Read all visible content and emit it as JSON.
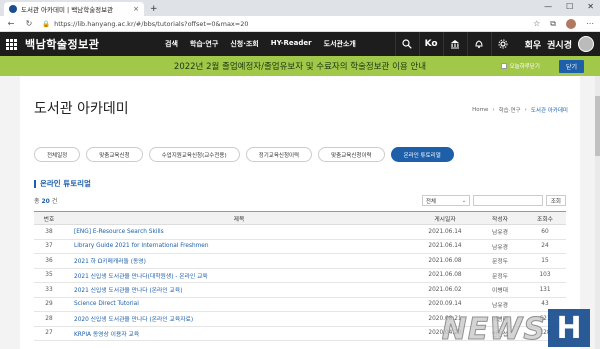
{
  "browser": {
    "tab_title": "도서관 아카데미 | 백남학술정보관",
    "tab_close": "×",
    "new_tab": "+",
    "win_min": "—",
    "win_max": "☐",
    "win_close": "✕",
    "url": "https://lib.hanyang.ac.kr/#/bbs/tutorials?offset=0&max=20"
  },
  "site": {
    "logo": "백남학술정보관",
    "nav": [
      "검색",
      "학습·연구",
      "신청·조회",
      "HY-Reader",
      "도서관소개"
    ],
    "lang_label": "Ko",
    "user_prefix": "회우",
    "user_name": "권시경"
  },
  "notice": {
    "text": "2022년 2월 졸업예정자/졸업유보자 및 수료자의 학술정보관 이용 안내",
    "checkbox_label": "오늘하루닫기",
    "close_label": "닫기"
  },
  "page": {
    "title": "도서관 아카데미",
    "breadcrumb": [
      "Home",
      "학습·연구",
      "도서관 아카데미"
    ],
    "tabs": [
      "전체일정",
      "맞춤교육신청",
      "수업지원교육신청(교수전용)",
      "정기교육신청이력",
      "맞춤교육신청이력",
      "온라인 튜토리얼"
    ],
    "active_tab": 5,
    "section_title": "온라인 튜토리얼",
    "total_prefix": "총",
    "total_count": "20",
    "total_suffix": "건",
    "search_select": "전체",
    "search_button": "조회"
  },
  "table": {
    "headers": [
      "번호",
      "제목",
      "게시일자",
      "작성자",
      "조회수"
    ],
    "rows": [
      {
        "no": "38",
        "title": "[ENG] E-Resource Search Skills",
        "date": "2021.06.14",
        "author": "남유경",
        "views": "60"
      },
      {
        "no": "37",
        "title": "Library Guide 2021 for International Freshmen",
        "date": "2021.06.14",
        "author": "남유경",
        "views": "24"
      },
      {
        "no": "36",
        "title": "2021 하 Ω키메캐러돌 (동영)",
        "date": "2021.06.08",
        "author": "문정두",
        "views": "15"
      },
      {
        "no": "35",
        "title": "2021 신입생 도서관을 만나다(대학원생) - 온라인 교육",
        "date": "2021.06.08",
        "author": "문정두",
        "views": "103"
      },
      {
        "no": "33",
        "title": "2021 신입생 도서관을 만나다 (온라인 교육)",
        "date": "2021.06.02",
        "author": "이병대",
        "views": "131"
      },
      {
        "no": "29",
        "title": "Science Direct Tutorial",
        "date": "2020.09.14",
        "author": "남유경",
        "views": "43"
      },
      {
        "no": "28",
        "title": "2020 신입생 도서관을 만나다 (온라인 교육자료)",
        "date": "2020.08.21",
        "author": "이병대",
        "views": "621"
      },
      {
        "no": "27",
        "title": "KRPIA 동영상 이용자 교육",
        "date": "2020.04.20",
        "author": "안신섭",
        "views": "128"
      }
    ]
  },
  "watermark": {
    "text": "NEWS",
    "letter": "H"
  }
}
